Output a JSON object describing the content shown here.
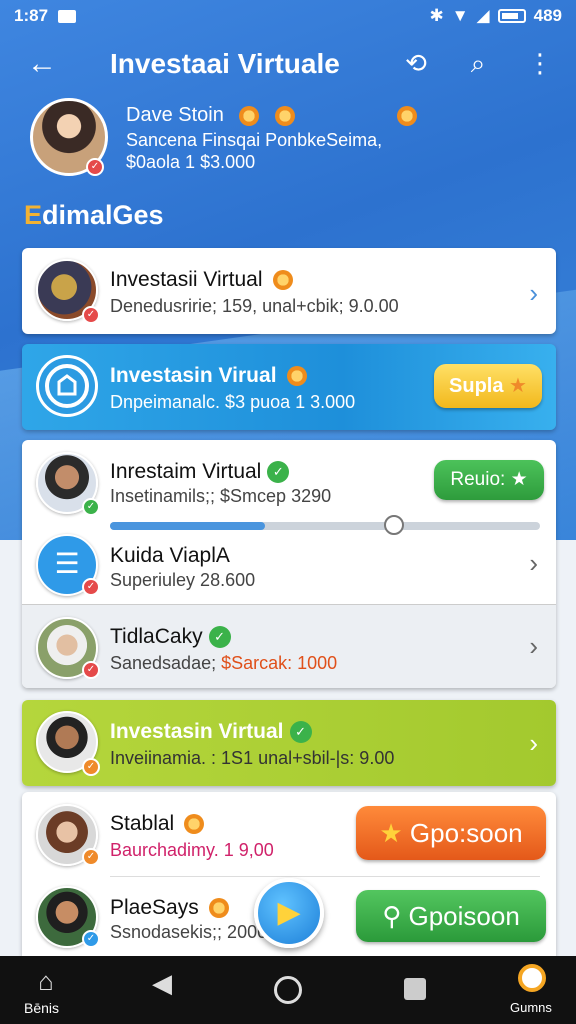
{
  "status_bar": {
    "time": "1:87",
    "battery": "489"
  },
  "app_bar": {
    "title": "Investaai Virtuale"
  },
  "profile": {
    "name": "Dave Stoin",
    "subtitle": "Sancena Finsqai PonbkeSeima,",
    "value": "$0aola 1 $3.000"
  },
  "section": {
    "title_first": "E",
    "title_rest": "dimalGes"
  },
  "items": [
    {
      "title": "Investasii Virtual",
      "subtitle": "Denedusririe; 159, unal+cbik; 9.0.00"
    },
    {
      "title": "Investasin Virual",
      "subtitle": "Dnpeimanalc. $3 puoa 1 3.000",
      "button": "Supla"
    },
    {
      "title": "Inrestaim Virtual",
      "subtitle": "Insetinamils;; $Smcep 3290",
      "button": "Reuio:",
      "progress": 0.36
    },
    {
      "title": "Kuida ViaplA",
      "subtitle": "Superiuley 28.600"
    },
    {
      "title": "TidlaCaky",
      "subtitle_prefix": "Sanedsadae; ",
      "subtitle_highlight": "$Sarcak: 1000"
    },
    {
      "title": "Investasin Virtual",
      "subtitle": "Inveiinamia. : 1S1 unal+sbil-|s: 9.00"
    },
    {
      "title": "Stablal",
      "subtitle": "Baurchadimy. 1 9,00",
      "button": "Gpo:soon"
    },
    {
      "title": "PlaeSays",
      "subtitle": "Ssnodasekis;; 2000",
      "button": "Gpoisoon"
    }
  ],
  "nav": {
    "left_label": "Bēnis",
    "right_label": "Gumns"
  },
  "colors": {
    "primary": "#2d72cf",
    "green": "#3bb24a",
    "orange": "#ef8a2a",
    "lime": "#a9cf32"
  },
  "icons": [
    "back-arrow-icon",
    "refresh-search-icon",
    "search-icon",
    "more-vert-icon",
    "coin-icon",
    "chevron-right-icon",
    "play-icon",
    "home-icon",
    "back-triangle-icon",
    "circle-home-icon",
    "square-recents-icon",
    "user-icon",
    "star-icon",
    "magnifier-icon"
  ]
}
